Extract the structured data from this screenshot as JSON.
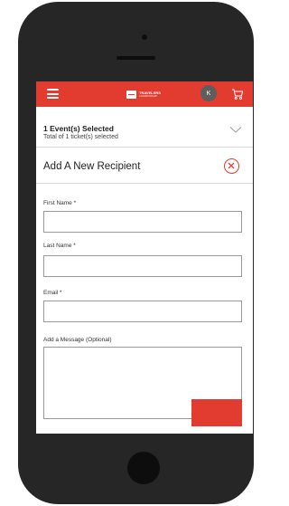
{
  "header": {
    "logo_text": "TRAVELERS",
    "logo_subtext": "CHAMPIONSHIP",
    "avatar_initial": "K"
  },
  "event_summary": {
    "selected_text": "1 Event(s) Selected",
    "ticket_text": "Total of 1 ticket(s) selected"
  },
  "form": {
    "title": "Add A New Recipient",
    "first_name_label": "First Name *",
    "last_name_label": "Last Name *",
    "email_label": "Email *",
    "message_label": "Add a Message (Optional)",
    "first_name_value": "",
    "last_name_value": "",
    "email_value": "",
    "message_value": ""
  },
  "colors": {
    "brand_red": "#e23b30",
    "phone_body": "#262626"
  }
}
